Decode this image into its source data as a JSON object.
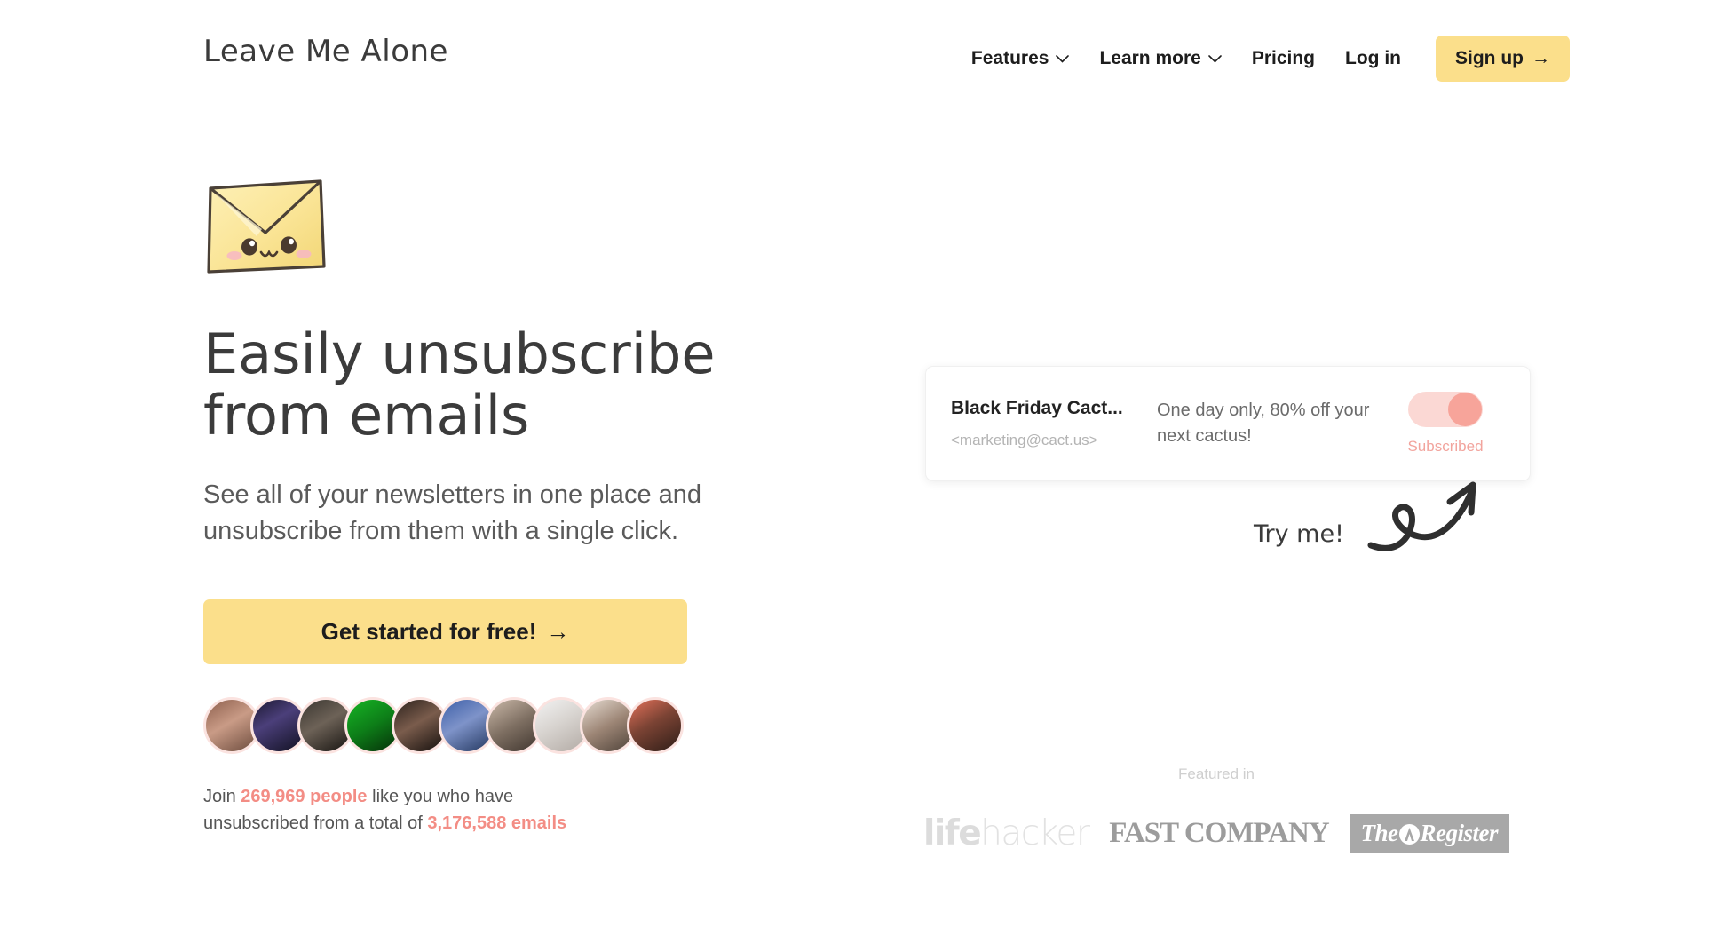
{
  "brand": {
    "logo_text": "Leave Me Alone",
    "accent_yellow": "#fbdf8b",
    "accent_coral": "#f38d85",
    "text_dark": "#3b3b3b"
  },
  "nav": {
    "items": [
      {
        "label": "Features",
        "has_dropdown": true,
        "icon": "chevron-down-icon"
      },
      {
        "label": "Learn more",
        "has_dropdown": true,
        "icon": "chevron-down-icon"
      },
      {
        "label": "Pricing",
        "has_dropdown": false
      },
      {
        "label": "Log in",
        "has_dropdown": false
      }
    ],
    "signup_label": "Sign up",
    "signup_arrow": "→"
  },
  "hero": {
    "mascot": "envelope-mascot-icon",
    "headline_line1": "Easily unsubscribe",
    "headline_line2": "from emails",
    "subhead": "See all of your newsletters in one place and unsubscribe from them with a single click.",
    "cta_label": "Get started for free!",
    "cta_arrow": "→",
    "avatar_count": 10,
    "stats": {
      "prefix": "Join ",
      "people_count": "269,969 people",
      "middle": " like you who have unsubscribed from a total of ",
      "emails_count": "3,176,588 emails"
    }
  },
  "email_card": {
    "sender_name": "Black Friday Cact...",
    "sender_address": "<marketing@cact.us>",
    "preview": "One day only, 80% off your next cactus!",
    "toggle_state": "on",
    "status_label": "Subscribed",
    "toggle_track_color": "#fbd8d4",
    "toggle_knob_color": "#f7a49a"
  },
  "annotation": {
    "text": "Try me!",
    "icon": "curly-arrow-icon"
  },
  "featured": {
    "label": "Featured in",
    "logos": [
      {
        "name": "lifehacker",
        "bold_part": "life",
        "light_part": "hacker"
      },
      {
        "name": "FAST COMPANY"
      },
      {
        "name": "The Register",
        "prefix": "The",
        "suffix": "Register"
      }
    ]
  }
}
